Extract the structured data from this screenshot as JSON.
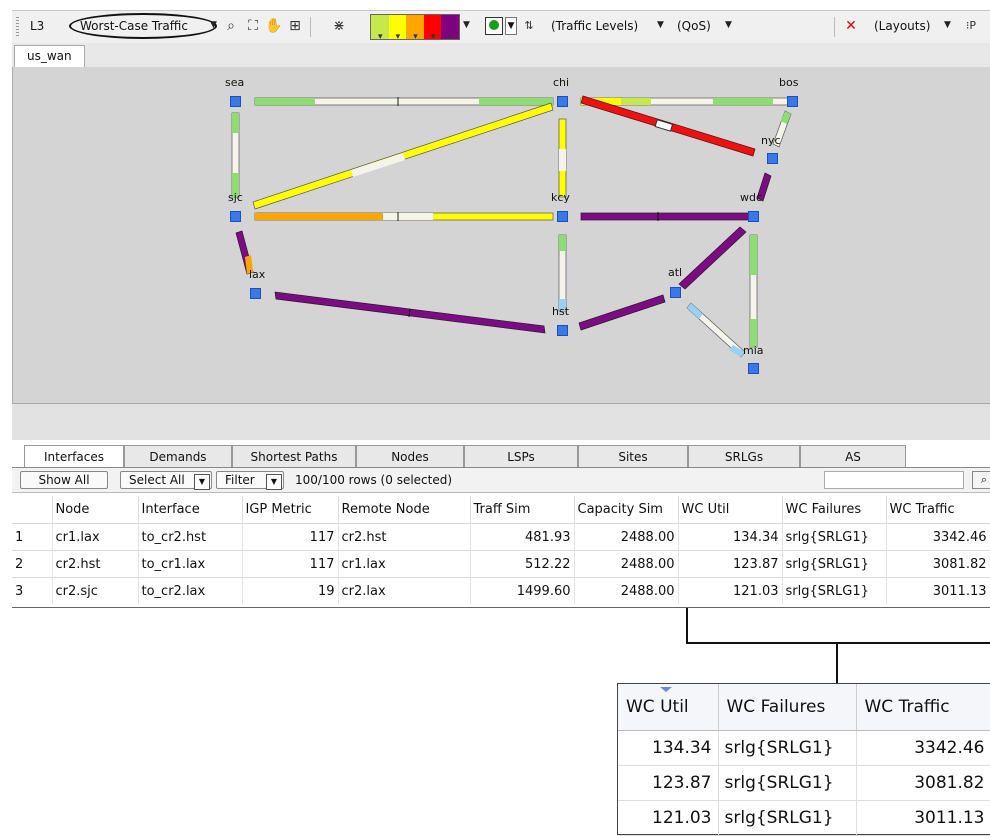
{
  "toolbar": {
    "layer": "L3",
    "plot_mode": "Worst-Case Traffic",
    "traffic_levels": "(Traffic Levels)",
    "qos": "(QoS)",
    "layouts": "(Layouts)",
    "traffic_colors": [
      "#c6e84a",
      "#ffff00",
      "#ffa500",
      "#ff0000",
      "#800080"
    ]
  },
  "map": {
    "tab": "us_wan",
    "nodes": [
      {
        "name": "sea"
      },
      {
        "name": "chi"
      },
      {
        "name": "bos"
      },
      {
        "name": "nyc"
      },
      {
        "name": "sjc"
      },
      {
        "name": "kcy"
      },
      {
        "name": "wdc"
      },
      {
        "name": "lax"
      },
      {
        "name": "atl"
      },
      {
        "name": "hst"
      },
      {
        "name": "mia"
      }
    ]
  },
  "table_tabs": [
    "Interfaces",
    "Demands",
    "Shortest Paths",
    "Nodes",
    "LSPs",
    "Sites",
    "SRLGs",
    "AS"
  ],
  "filter_bar": {
    "show_all": "Show All",
    "select_all": "Select All",
    "filter": "Filter",
    "row_count": "100/100 rows (0 selected)"
  },
  "interfaces_table": {
    "columns": [
      "",
      "Node",
      "Interface",
      "IGP Metric",
      "Remote Node",
      "Traff Sim",
      "Capacity Sim",
      "WC Util",
      "WC Failures",
      "WC Traffic"
    ],
    "rows": [
      [
        "1",
        "cr1.lax",
        "to_cr2.hst",
        "117",
        "cr2.hst",
        "481.93",
        "2488.00",
        "134.34",
        "srlg{SRLG1}",
        "3342.46"
      ],
      [
        "2",
        "cr2.hst",
        "to_cr1.lax",
        "117",
        "cr1.lax",
        "512.22",
        "2488.00",
        "123.87",
        "srlg{SRLG1}",
        "3081.82"
      ],
      [
        "3",
        "cr2.sjc",
        "to_cr2.lax",
        "19",
        "cr2.lax",
        "1499.60",
        "2488.00",
        "121.03",
        "srlg{SRLG1}",
        "3011.13"
      ]
    ]
  },
  "zoom_table": {
    "columns": [
      "WC Util",
      "WC Failures",
      "WC Traffic"
    ],
    "rows": [
      [
        "134.34",
        "srlg{SRLG1}",
        "3342.46"
      ],
      [
        "123.87",
        "srlg{SRLG1}",
        "3081.82"
      ],
      [
        "121.03",
        "srlg{SRLG1}",
        "3011.13"
      ]
    ]
  }
}
